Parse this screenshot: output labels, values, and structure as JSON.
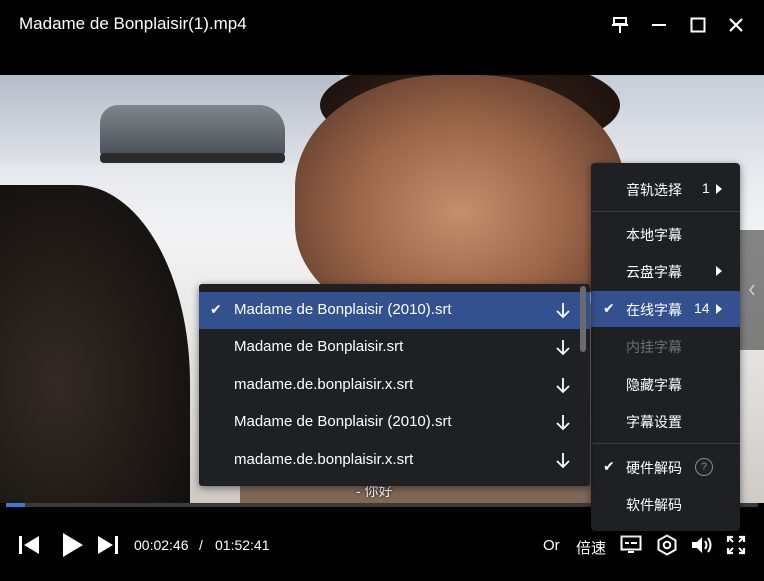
{
  "window": {
    "title": "Madame de Bonplaisir(1).mp4",
    "buttons": [
      "pin-icon",
      "minimize-icon",
      "maximize-icon",
      "close-icon"
    ]
  },
  "video": {
    "subtitle_line": "- 你好"
  },
  "playback": {
    "current_time": "00:02:46",
    "separator": "/",
    "total_time": "01:52:41",
    "progress_fraction": 0.025,
    "text_buttons": {
      "or": "Or",
      "speed": "倍速"
    }
  },
  "menu": {
    "items": [
      {
        "label": "音轨选择",
        "value": "1",
        "has_submenu": true
      },
      {
        "label": "本地字幕"
      },
      {
        "label": "云盘字幕",
        "has_submenu": true
      },
      {
        "label": "在线字幕",
        "value": "14",
        "has_submenu": true,
        "checked": true,
        "active": true
      },
      {
        "label": "内挂字幕",
        "disabled": true
      },
      {
        "label": "隐藏字幕"
      },
      {
        "label": "字幕设置"
      },
      {
        "label": "硬件解码",
        "checked": true,
        "help": "?"
      },
      {
        "label": "软件解码"
      }
    ],
    "check_glyph": "✔"
  },
  "subtitles": {
    "items": [
      {
        "label": "Madame de Bonplaisir (2010).srt",
        "checked": true
      },
      {
        "label": "Madame de Bonplaisir.srt"
      },
      {
        "label": "madame.de.bonplaisir.x.srt"
      },
      {
        "label": "Madame de Bonplaisir (2010).srt"
      },
      {
        "label": "madame.de.bonplaisir.x.srt"
      }
    ]
  },
  "colors": {
    "accent": "#3a7bd5",
    "menu_bg": "#1f2024",
    "active_bg": "#33518f"
  }
}
